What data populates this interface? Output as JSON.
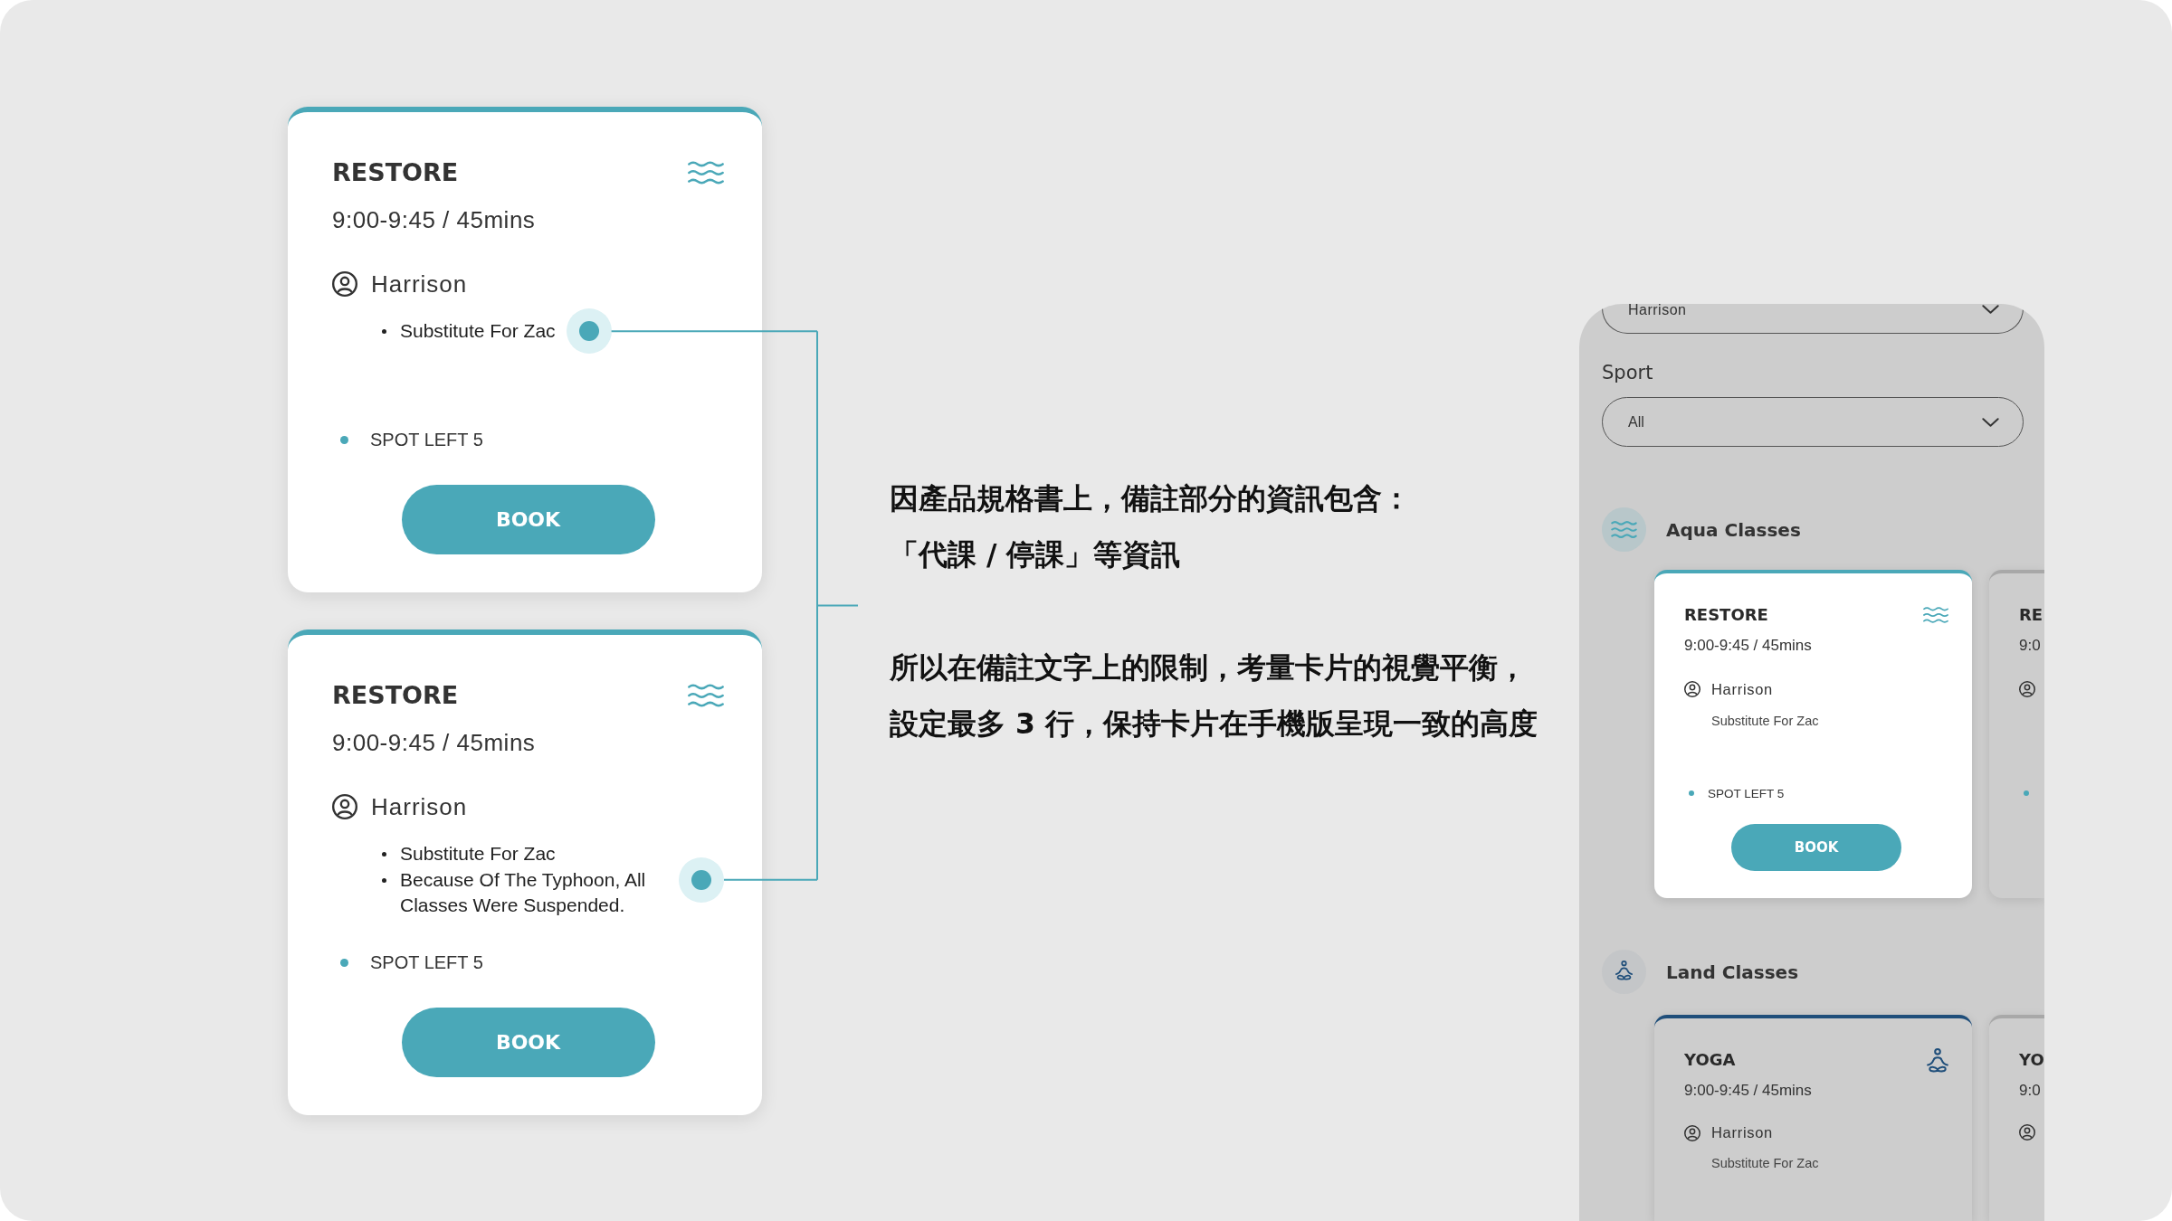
{
  "cards": [
    {
      "title": "RESTORE",
      "time": "9:00-9:45 / 45mins",
      "instructor": "Harrison",
      "notes": [
        "Substitute For Zac"
      ],
      "spots": "SPOT LEFT 5",
      "button": "BOOK"
    },
    {
      "title": "RESTORE",
      "time": "9:00-9:45 / 45mins",
      "instructor": "Harrison",
      "notes": [
        "Substitute For Zac",
        "Because Of The Typhoon, All Classes Were Suspended."
      ],
      "spots": "SPOT LEFT 5",
      "button": "BOOK"
    }
  ],
  "annotation": [
    {
      "lines": [
        "因產品規格書上，備註部分的資訊包含：",
        "「代課 / 停課」等資訊"
      ]
    },
    {
      "lines": [
        "所以在備註文字上的限制，考量卡片的視覺平衡，",
        "設定最多 3 行，保持卡片在手機版呈現一致的高度"
      ]
    }
  ],
  "phone": {
    "instructor_field": {
      "value": "Harrison"
    },
    "sport_field": {
      "label": "Sport",
      "value": "All"
    },
    "sections": [
      {
        "kind": "aqua",
        "title": "Aqua Classes",
        "color": "#4aa8b8",
        "cards": [
          {
            "kind": "full",
            "highlighted": true,
            "title": "RESTORE",
            "time": "9:00-9:45 / 45mins",
            "instructor": "Harrison",
            "note": "Substitute For Zac",
            "spots": "SPOT LEFT 5",
            "button": "BOOK"
          },
          {
            "kind": "partial",
            "highlighted": false,
            "title": "RE",
            "time": "9:0",
            "spot_dot": true
          }
        ]
      },
      {
        "kind": "land",
        "title": "Land Classes",
        "color": "#1f4e7a",
        "cards": [
          {
            "kind": "full",
            "highlighted": false,
            "title": "YOGA",
            "time": "9:00-9:45 / 45mins",
            "instructor": "Harrison",
            "note": "Substitute For Zac"
          },
          {
            "kind": "partial",
            "highlighted": false,
            "title": "YO",
            "time": "9:0"
          }
        ]
      }
    ]
  }
}
